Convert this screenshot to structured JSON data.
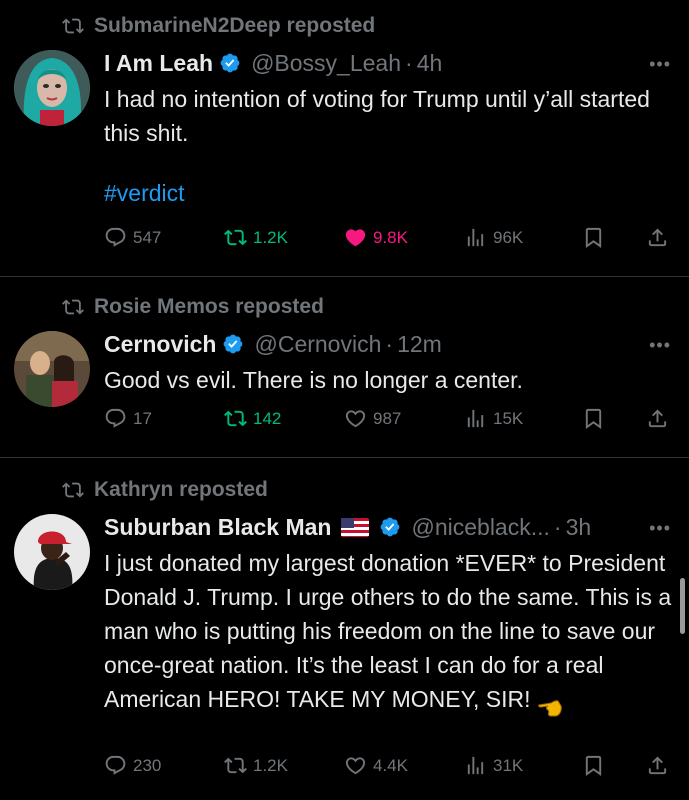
{
  "colors": {
    "accent": "#1d9bf0",
    "muted": "#71767b",
    "repost_green": "#00ba7c",
    "like_pink": "#f91880",
    "background": "#000000"
  },
  "tweets": [
    {
      "reposted_by": "SubmarineN2Deep reposted",
      "author_name": "I Am Leah",
      "handle": "@Bossy_Leah",
      "time": "4h",
      "text": "I had no intention of voting for Trump until y’all started this shit.",
      "hashtag": "#verdict",
      "replies": "547",
      "reposts": "1.2K",
      "likes": "9.8K",
      "views": "96K",
      "reposted_state": "none",
      "liked": true
    },
    {
      "reposted_by": "Rosie Memos reposted",
      "author_name": "Cernovich",
      "handle": "@Cernovich",
      "time": "12m",
      "text": "Good vs evil. There is no longer a center.",
      "replies": "17",
      "reposts": "142",
      "likes": "987",
      "views": "15K",
      "reposted_state": "reposted",
      "liked": false
    },
    {
      "reposted_by": "Kathryn reposted",
      "author_name": "Suburban Black Man",
      "handle": "@niceblack...",
      "time": "3h",
      "text": "I just donated my largest donation *EVER* to President Donald J. Trump. I urge others to do the same. This is a man who is putting his freedom on the line to save our once-great nation. It’s the least I can do for a real American HERO! TAKE MY MONEY, SIR!",
      "name_emoji": "us-flag-icon",
      "text_emoji": "pointing-hand-icon",
      "replies": "230",
      "reposts": "1.2K",
      "likes": "4.4K",
      "views": "31K",
      "reposted_state": "none",
      "liked": false
    }
  ]
}
